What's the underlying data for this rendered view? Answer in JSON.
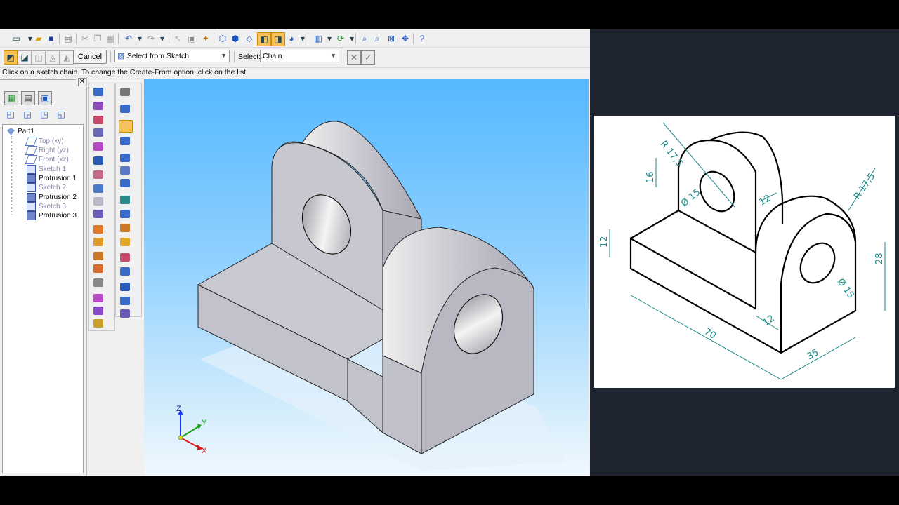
{
  "ribbon": {
    "cancel_label": "Cancel",
    "create_from": "Select from Sketch",
    "select_label": "Select:",
    "select_value": "Chain"
  },
  "prompt": "Click on a sketch chain.  To change the Create-From option, click on the list.",
  "tree": {
    "root": "Part1",
    "items": [
      {
        "label": "Top (xy)",
        "state": "inactive"
      },
      {
        "label": "Right (yz)",
        "state": "inactive"
      },
      {
        "label": "Front (xz)",
        "state": "inactive"
      },
      {
        "label": "Sketch 1",
        "state": "inactive"
      },
      {
        "label": "Protrusion 1",
        "state": "active"
      },
      {
        "label": "Sketch 2",
        "state": "inactive"
      },
      {
        "label": "Protrusion 2",
        "state": "active"
      },
      {
        "label": "Sketch 3",
        "state": "inactive"
      },
      {
        "label": "Protrusion 3",
        "state": "active"
      }
    ]
  },
  "triad": {
    "x": "X",
    "y": "Y",
    "z": "Z"
  },
  "drawing": {
    "dims": {
      "r1": "R 17,5",
      "r2": "R 17,5",
      "h16": "16",
      "d1": "Ø 15",
      "d2": "Ø 15",
      "w12a": "12",
      "h12": "12",
      "w12b": "12",
      "h28": "28",
      "l70": "70",
      "w35": "35"
    }
  },
  "colors": {
    "viewport_top": "#55b8ff",
    "part_face": "#b7b7c2",
    "dimension": "#1a8a8a",
    "right_background": "#1f2530"
  }
}
